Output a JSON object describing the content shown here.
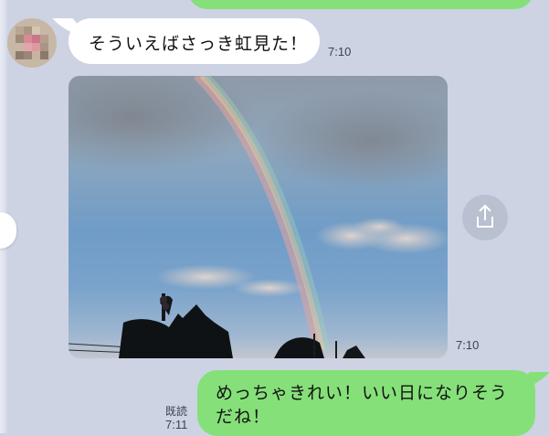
{
  "messages": [
    {
      "type": "incoming_text",
      "text": "そういえばさっき虹見た！",
      "time": "7:10"
    },
    {
      "type": "incoming_image",
      "image_subject": "rainbow-over-trees-photo",
      "time": "7:10"
    },
    {
      "type": "outgoing_text",
      "text": "めっちゃきれい！いい日になりそうだね！",
      "read_label": "既読",
      "time": "7:11"
    }
  ],
  "colors": {
    "background": "#cdd3e3",
    "outgoing_bubble": "#86e07a",
    "incoming_bubble": "#ffffff",
    "share_button": "#b9c0cf"
  },
  "icons": {
    "share": "share-icon"
  }
}
